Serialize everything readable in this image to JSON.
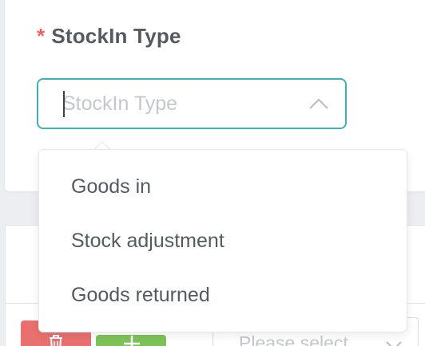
{
  "form": {
    "required_mark": "*",
    "stockin_type_label": "StockIn Type",
    "stockin_type_placeholder": "StockIn Type",
    "stockin_type_value": ""
  },
  "dropdown": {
    "options": [
      {
        "label": "Goods in"
      },
      {
        "label": "Stock adjustment"
      },
      {
        "label": "Goods returned"
      }
    ]
  },
  "lower_row": {
    "select_placeholder": "Please select"
  },
  "colors": {
    "accent": "#3fb1b0",
    "required": "#f06262",
    "delete": "#e9706f",
    "add": "#7fc25a"
  },
  "icons": {
    "select_toggle": "chevron-up-icon",
    "delete": "trash-icon",
    "add": "plus-icon",
    "row_select_toggle": "chevron-down-icon"
  }
}
